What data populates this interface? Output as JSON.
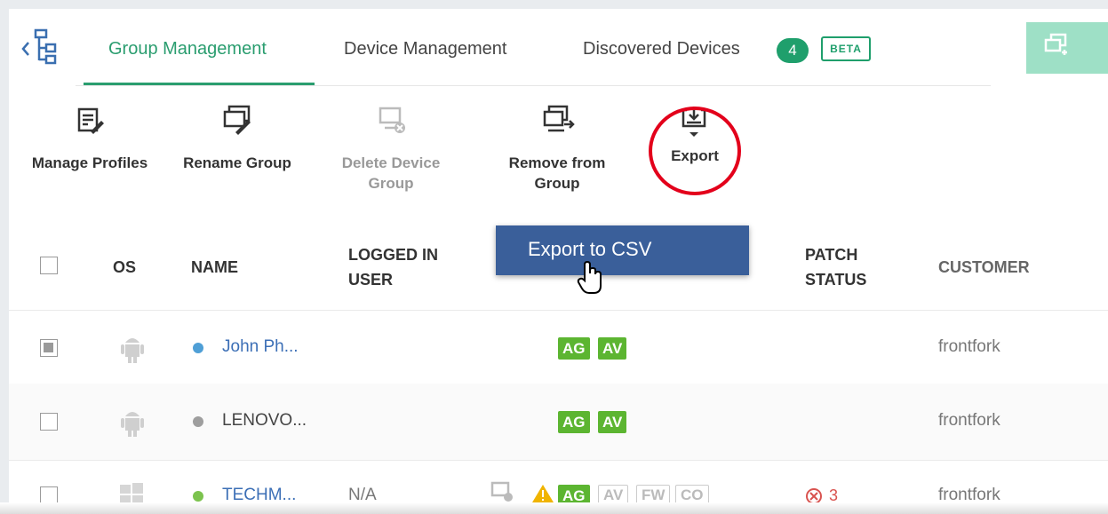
{
  "tabs": [
    {
      "label": "Group Management",
      "active": true
    },
    {
      "label": "Device Management",
      "active": false
    },
    {
      "label": "Discovered Devices",
      "active": false
    }
  ],
  "discovered_count": "4",
  "beta_label": "BETA",
  "toolbar": {
    "manage_profiles": "Manage Profiles",
    "rename_group": "Rename Group",
    "delete_device_group_1": "Delete Device",
    "delete_device_group_2": "Group",
    "remove_from_group_1": "Remove from",
    "remove_from_group_2": "Group",
    "export": "Export"
  },
  "export_menu": {
    "item": "Export to CSV"
  },
  "table": {
    "headers": {
      "os": "OS",
      "name": "NAME",
      "logged_in_user_1": "LOGGED IN",
      "logged_in_user_2": "USER",
      "patch_status_1": "PATCH",
      "patch_status_2": "STATUS",
      "customer": "CUSTOMER"
    },
    "rows": [
      {
        "name": "John Ph...",
        "os": "android",
        "status_color": "#4f9fd6",
        "logged_in_user": "",
        "tags": [
          "AG",
          "AV"
        ],
        "customer": "frontfork",
        "selected": true
      },
      {
        "name": "LENOVO...",
        "os": "android",
        "status_color": "#9e9e9e",
        "logged_in_user": "",
        "tags": [
          "AG",
          "AV"
        ],
        "customer": "frontfork",
        "selected": false
      },
      {
        "name": "TECHM...",
        "os": "windows",
        "status_color": "#7cc34e",
        "logged_in_user": "N/A",
        "tags": [
          "AG",
          "AV",
          "FW",
          "CO"
        ],
        "patch": "3",
        "customer": "frontfork",
        "selected": false
      }
    ]
  },
  "colors": {
    "accent": "#2a9d6f",
    "dropdown_bg": "#3a5f9a",
    "highlight_circle": "#e3001b",
    "tag_green": "#5cb531",
    "link": "#3c6fb6"
  }
}
